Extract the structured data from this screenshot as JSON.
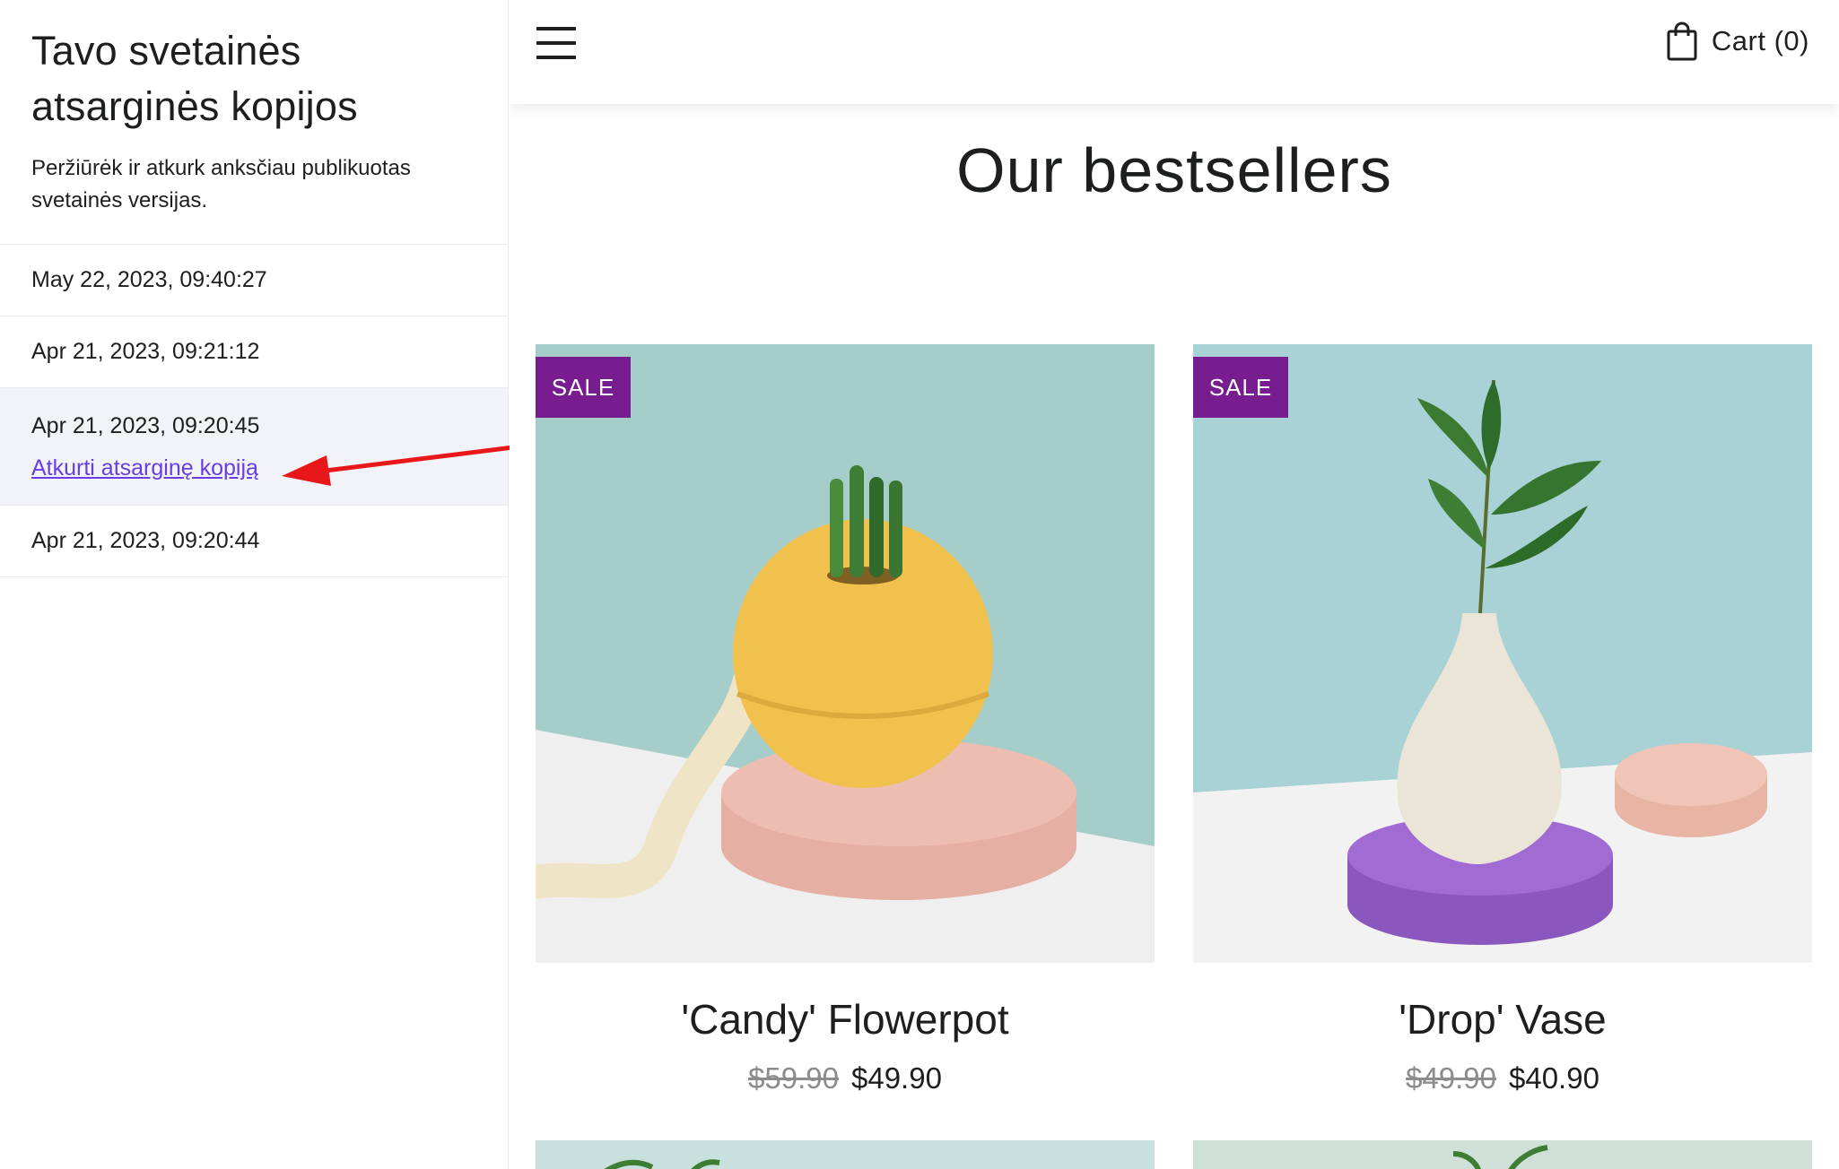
{
  "sidebar": {
    "title": "Tavo svetainės atsarginės kopijos",
    "subtitle": "Peržiūrėk ir atkurk anksčiau publikuotas svetainės versijas.",
    "backups": [
      {
        "date": "May 22, 2023, 09:40:27"
      },
      {
        "date": "Apr 21, 2023, 09:21:12"
      },
      {
        "date": "Apr 21, 2023, 09:20:45",
        "selected": true,
        "restore_label": "Atkurti atsarginę kopiją"
      },
      {
        "date": "Apr 21, 2023, 09:20:44"
      }
    ]
  },
  "site": {
    "menu_icon": "hamburger-menu-icon",
    "cart_icon": "shopping-bag-icon",
    "cart_label": "Cart (0)",
    "section_title": "Our bestsellers",
    "products": [
      {
        "badge": "SALE",
        "name": "'Candy' Flowerpot",
        "old_price": "$59.90",
        "new_price": "$49.90"
      },
      {
        "badge": "SALE",
        "name": "'Drop' Vase",
        "old_price": "$49.90",
        "new_price": "$40.90"
      }
    ]
  },
  "colors": {
    "accent_link": "#673de6",
    "sale_badge": "#771d8f",
    "annotation_arrow": "#e8171a",
    "selected_row": "#f2f3f6"
  }
}
